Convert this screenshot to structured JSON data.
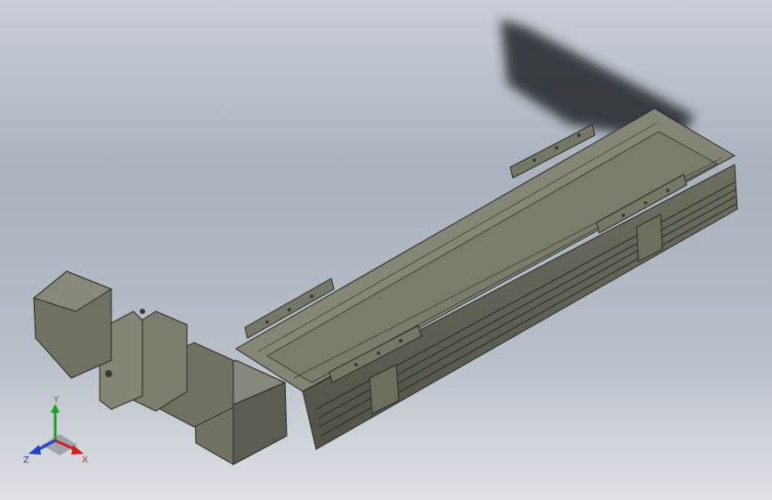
{
  "viewport": {
    "background_top": "#c9ced6",
    "background_bottom": "#dfe2e6"
  },
  "model": {
    "description_icon": "linear-actuator-3d-model",
    "body_color": "#7f8271",
    "shadow_color": "#2a2d33"
  },
  "triad": {
    "x_label": "X",
    "y_label": "Y",
    "z_label": "Z",
    "x_color": "#d32020",
    "y_color": "#1fa01f",
    "z_color": "#2040d0"
  }
}
